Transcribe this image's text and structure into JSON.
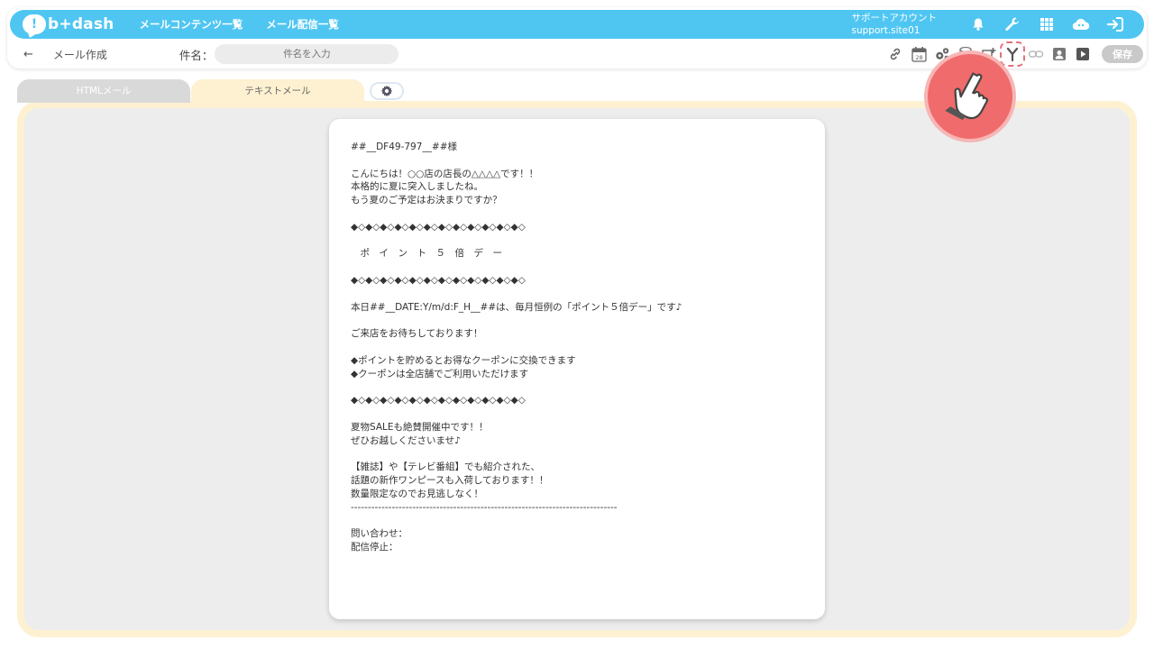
{
  "app": {
    "logo_text": "b+dash",
    "nav": [
      "メールコンテンツ一覧",
      "メール配信一覧"
    ],
    "account_name": "サポートアカウント",
    "account_site": "support.site01",
    "brand_color": "#4fc6f2"
  },
  "header_icons": [
    "bell-icon",
    "wrench-icon",
    "grid-icon",
    "cloud-icon",
    "logout-icon"
  ],
  "toolbar": {
    "back_label": "←",
    "page_title": "メール作成",
    "subject_label": "件名：",
    "subject_placeholder": "件名を入力",
    "save_label": "保存",
    "tool_icons": [
      "link-icon",
      "calendar-icon",
      "gear-cluster-icon",
      "database-icon",
      "add-block-icon",
      "branch-icon",
      "chain-icon",
      "contact-icon",
      "play-icon"
    ],
    "calendar_day": "28"
  },
  "tabs": {
    "html_label": "HTMLメール",
    "text_label": "テキストメール"
  },
  "mail_body": [
    "##__DF49-797__##様",
    "",
    "こんにちは！○○店の店長の△△△△です！！",
    "本格的に夏に突入しましたね。",
    "もう夏のご予定はお決まりですか？",
    "",
    "◆◇◆◇◆◇◆◇◆◇◆◇◆◇◆◇◆◇◆◇◆◇◆◇",
    "",
    "　ポ　イ　ン　ト　５　倍　デ　ー",
    "",
    "◆◇◆◇◆◇◆◇◆◇◆◇◆◇◆◇◆◇◆◇◆◇◆◇",
    "",
    "本日##__DATE:Y/m/d:F_H__##は、毎月恒例の「ポイント５倍デー」です♪",
    "",
    "ご来店をお待ちしております！",
    "",
    "◆ポイントを貯めるとお得なクーポンに交換できます",
    "◆クーポンは全店舗でご利用いただけます",
    "",
    "◆◇◆◇◆◇◆◇◆◇◆◇◆◇◆◇◆◇◆◇◆◇◆◇",
    "",
    "夏物SALEも絶賛開催中です！！",
    "ぜひお越しくださいませ♪",
    "",
    "【雑誌】や【テレビ番組】でも紹介された、",
    "話題の新作ワンピースも入荷しております！！",
    "数量限定なのでお見逃しなく！",
    "------------------------------------------------------------------------------",
    "",
    "問い合わせ：",
    "配信停止："
  ]
}
